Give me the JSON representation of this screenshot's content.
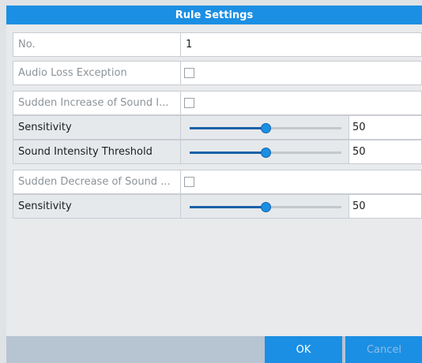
{
  "dialog": {
    "title": "Rule Settings"
  },
  "rows": {
    "no": {
      "label": "No.",
      "value": "1"
    },
    "audio_loss": {
      "label": "Audio Loss Exception",
      "checked": false
    },
    "sudden_increase": {
      "label": "Sudden Increase of Sound I...",
      "checked": false
    },
    "sensitivity_1": {
      "label": "Sensitivity",
      "value": "50",
      "level_percent": 50
    },
    "threshold": {
      "label": "Sound Intensity Threshold",
      "value": "50",
      "level_percent": 50
    },
    "sudden_decrease": {
      "label": "Sudden Decrease of Sound ...",
      "checked": false
    },
    "sensitivity_2": {
      "label": "Sensitivity",
      "value": "50",
      "level_percent": 50
    }
  },
  "buttons": {
    "ok_label": "OK",
    "cancel_label": "Cancel"
  },
  "colors": {
    "accent": "#1b8fe3",
    "disabled_text": "#8c9399"
  }
}
